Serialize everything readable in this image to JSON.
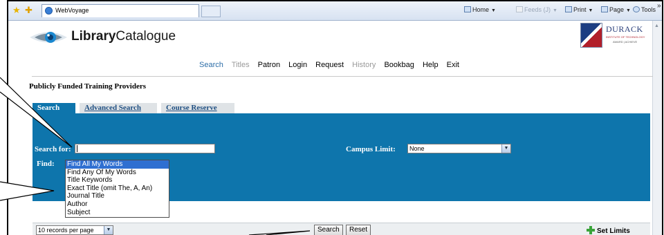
{
  "browser": {
    "tab_title": "WebVoyage",
    "toolbar": {
      "home": "Home",
      "feeds": "Feeds (J)",
      "print": "Print",
      "page": "Page",
      "tools": "Tools",
      "overflow": "»"
    }
  },
  "header": {
    "logo_bold": "Library",
    "logo_rest": "Catalogue",
    "institution": "DURACK",
    "institution_sub": "INSTITUTE OF TECHNOLOGY",
    "institution_sub2": "AWARD | ACHIEVE"
  },
  "nav": {
    "items": [
      {
        "label": "Search",
        "state": "active"
      },
      {
        "label": "Titles",
        "state": "disabled"
      },
      {
        "label": "Patron",
        "state": "normal"
      },
      {
        "label": "Login",
        "state": "normal"
      },
      {
        "label": "Request",
        "state": "normal"
      },
      {
        "label": "History",
        "state": "disabled"
      },
      {
        "label": "Bookbag",
        "state": "normal"
      },
      {
        "label": "Help",
        "state": "normal"
      },
      {
        "label": "Exit",
        "state": "normal"
      }
    ]
  },
  "org_title": "Publicly Funded Training Providers",
  "search_tabs": {
    "basic": "Search",
    "advanced": "Advanced Search",
    "course": "Course Reserve"
  },
  "form": {
    "search_for_label": "Search for:",
    "search_value": "",
    "campus_label": "Campus Limit:",
    "campus_value": "None",
    "find_label": "Find:",
    "find_options": [
      "Find All My Words",
      "Find Any Of My Words",
      "Title Keywords",
      "Exact Title (omit The, A, An)",
      "Journal Title",
      "Author",
      "Subject"
    ],
    "find_selected": 0
  },
  "footer": {
    "records_per_page": "10 records per page",
    "search_button": "Search",
    "reset_button": "Reset",
    "set_limits": "Set Limits"
  },
  "colors": {
    "panel_blue": "#0e75ac",
    "nav_active": "#2d6ea8",
    "selected_option": "#2f6fd1"
  }
}
